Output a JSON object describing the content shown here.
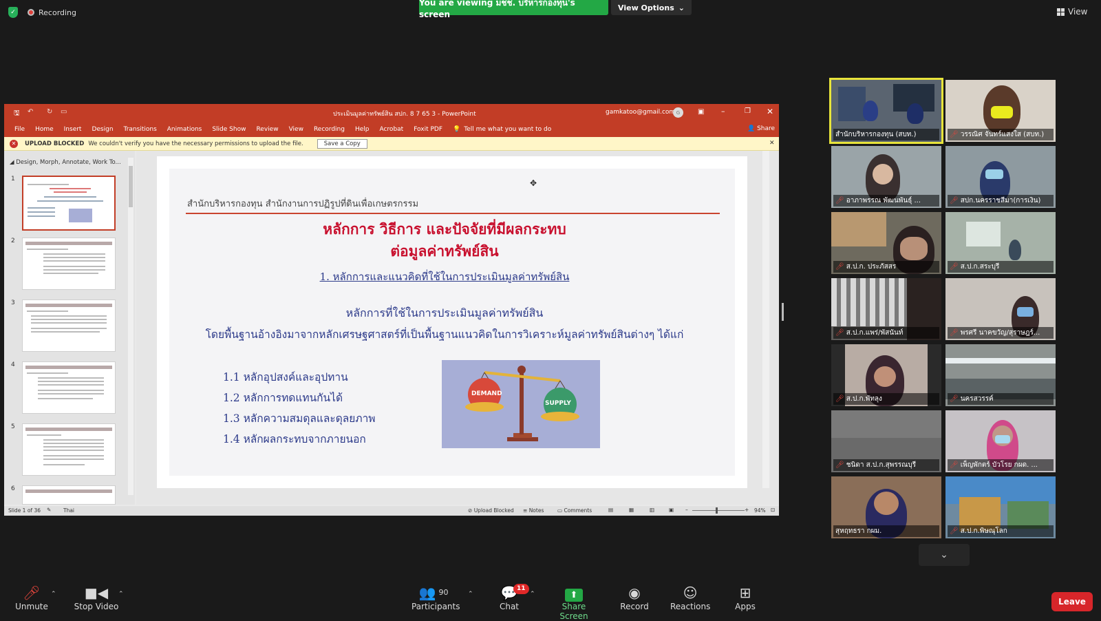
{
  "zoom": {
    "recording_label": "Recording",
    "viewing_banner": "You are viewing มชช. บริหารกองทุน's screen",
    "view_options": "View Options",
    "view_label": "View",
    "toolbar": {
      "unmute": "Unmute",
      "stop_video": "Stop Video",
      "participants": "Participants",
      "participants_count": "90",
      "chat": "Chat",
      "chat_badge": "11",
      "share_screen": "Share Screen",
      "record": "Record",
      "reactions": "Reactions",
      "apps": "Apps",
      "leave": "Leave"
    },
    "accent_green": "#23a845",
    "leave_red": "#d7262a"
  },
  "ppt": {
    "title": "ประเมินมูลค่าทรัพย์สิน สปก. 8 7 65  3  -  PowerPoint",
    "account": "gamkatoo@gmail.com",
    "account_initial": "G",
    "menu": [
      "File",
      "Home",
      "Insert",
      "Design",
      "Transitions",
      "Animations",
      "Slide Show",
      "Review",
      "View",
      "Recording",
      "Help",
      "Acrobat",
      "Foxit PDF"
    ],
    "tell_me": "Tell me what you want to do",
    "share": "Share",
    "alert_title": "UPLOAD BLOCKED",
    "alert_text": "We couldn't verify you have the necessary permissions to upload the file.",
    "alert_button": "Save a Copy",
    "thumbs_header": "Design, Morph, Annotate, Work To...",
    "thumb_numbers": [
      "1",
      "2",
      "3",
      "4",
      "5",
      "6"
    ],
    "status": {
      "slide": "Slide 1 of 36",
      "language": "Thai",
      "upload_blocked": "Upload Blocked",
      "notes": "Notes",
      "comments": "Comments",
      "zoom": "94%"
    },
    "theme_red": "#c23d26"
  },
  "slide": {
    "org": "สำนักบริหารกองทุน สำนักงานการปฏิรูปที่ดินเพื่อเกษตรกรรม",
    "title_line1": "หลักการ วิธีการ และปัจจัยที่มีผลกระทบ",
    "title_line2": "ต่อมูลค่าทรัพย์สิน",
    "subtitle": "1. หลักการและแนวคิดที่ใช้ในการประเมินมูลค่าทรัพย์สิน",
    "para1": "หลักการที่ใช้ในการประเมินมูลค่าทรัพย์สิน",
    "para2": "โดยพื้นฐานอ้างอิงมาจากหลักเศรษฐศาสตร์ที่เป็นพื้นฐานแนวคิดในการวิเคราะห์มูลค่าทรัพย์สินต่างๆ ได้แก่",
    "bullets": [
      "1.1 หลักอุปสงค์และอุปทาน",
      "1.2 หลักการทดแทนกันได้",
      "1.3 หลักความสมดุลและดุลยภาพ",
      "1.4 หลักผลกระทบจากภายนอก"
    ],
    "image_labels": {
      "demand": "DEMAND",
      "supply": "SUPPLY"
    }
  },
  "gallery": [
    {
      "name": "สำนักบริหารกองทุน (สบท.)",
      "muted": false,
      "bg": "#5a6470"
    },
    {
      "name": "วรรณิศ จันทร์แสงใส (สบท.)",
      "muted": true,
      "bg": "#d9d2c8"
    },
    {
      "name": "อาภาพรรณ พัฒนพันธุ์ ...",
      "muted": true,
      "bg": "#9aa4a8"
    },
    {
      "name": "สปก.นครราชสีมา(การเงิน)",
      "muted": true,
      "bg": "#8e9aa0"
    },
    {
      "name": "ส.ป.ก. ประภัสสร",
      "muted": true,
      "bg": "#6e6a5e"
    },
    {
      "name": "ส.ป.ก.สระบุรี",
      "muted": true,
      "bg": "#a6b2a8"
    },
    {
      "name": "ส.ป.ก.แพร่/พัสนันท์",
      "muted": true,
      "bg": "#5c5a58"
    },
    {
      "name": "พรศรี นาคขวัญ/สุราษฎร์...",
      "muted": true,
      "bg": "#c8c2bc"
    },
    {
      "name": "ส.ป.ก.พัทลุง",
      "muted": true,
      "bg": "#b8aca4"
    },
    {
      "name": "นครสวรรค์",
      "muted": true,
      "bg": "#8c9290"
    },
    {
      "name": "ชนิดา ส.ป.ก.สุพรรณบุรี",
      "muted": true,
      "bg": "#6a6a6a"
    },
    {
      "name": "เพ็ญพักตร์ บัวโรย กผด. ...",
      "muted": true,
      "bg": "#c6c2c6"
    },
    {
      "name": "สุหฤทธรา กผม.",
      "muted": false,
      "bg": "#8a6e58"
    },
    {
      "name": "ส.ป.ก.พิษณุโลก",
      "muted": true,
      "bg": "#6e8aa0"
    }
  ]
}
